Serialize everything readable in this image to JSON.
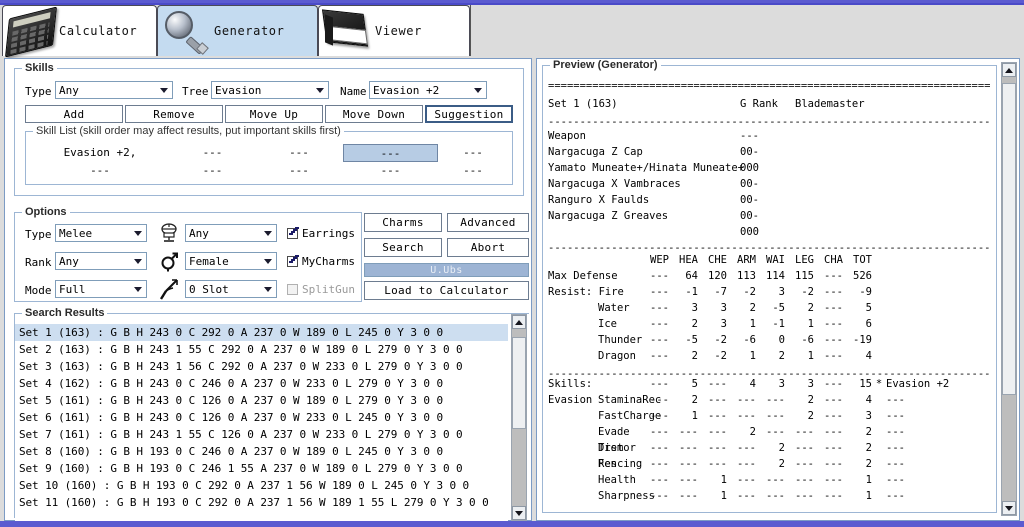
{
  "window": {
    "accent_color": "#5b5bd0",
    "bg_color": "#dcdcdc"
  },
  "tabs": [
    {
      "label": "Calculator",
      "icon": "calculator-icon",
      "active": false
    },
    {
      "label": "Generator",
      "icon": "magnifier-icon",
      "active": true
    },
    {
      "label": "Viewer",
      "icon": "book-icon",
      "active": false
    }
  ],
  "skills": {
    "group_label": "Skills",
    "type_label": "Type",
    "type_value": "Any",
    "tree_label": "Tree",
    "tree_value": "Evasion",
    "name_label": "Name",
    "name_value": "Evasion +2",
    "buttons": [
      {
        "label": "Add",
        "focus": false
      },
      {
        "label": "Remove",
        "focus": false
      },
      {
        "label": "Move Up",
        "focus": false
      },
      {
        "label": "Move Down",
        "focus": false
      },
      {
        "label": "Suggestion",
        "focus": true
      }
    ],
    "skill_list_label": "Skill List  (skill order may affect results, put important skills first)",
    "skill_cells": [
      [
        {
          "text": "Evasion +2,",
          "sel": false
        },
        {
          "text": "---",
          "sel": false
        },
        {
          "text": "---",
          "sel": false
        },
        {
          "text": "---",
          "sel": true
        },
        {
          "text": "---",
          "sel": false
        }
      ],
      [
        {
          "text": "---",
          "sel": false
        },
        {
          "text": "---",
          "sel": false
        },
        {
          "text": "---",
          "sel": false
        },
        {
          "text": "---",
          "sel": false
        },
        {
          "text": "---",
          "sel": false
        }
      ]
    ]
  },
  "options": {
    "group_label": "Options",
    "rows": [
      {
        "label": "Type",
        "value": "Melee"
      },
      {
        "label": "Rank",
        "value": "Any"
      },
      {
        "label": "Mode",
        "value": "Full"
      }
    ],
    "icon_rows": [
      {
        "icon": "armor-helmet-icon",
        "value": "Any"
      },
      {
        "icon": "gender-icon",
        "value": "Female"
      },
      {
        "icon": "weapon-icon",
        "value": "0 Slot"
      }
    ],
    "checks": [
      {
        "label": "Earrings",
        "checked": true,
        "disabled": false
      },
      {
        "label": "MyCharms",
        "checked": true,
        "disabled": false
      },
      {
        "label": "SplitGun",
        "checked": false,
        "disabled": true
      }
    ],
    "action_buttons": [
      {
        "label": "Charms"
      },
      {
        "label": "Advanced"
      },
      {
        "label": "Search"
      },
      {
        "label": "Abort"
      }
    ],
    "progress": {
      "text": "U.Ubs",
      "percent": 100,
      "fill_color": "#9db4d4"
    },
    "load_button": "Load to Calculator"
  },
  "search_results": {
    "group_label": "Search Results",
    "rows": [
      {
        "text": "Set 1 (163) : G B H 243 0 C 292 0 A 237 0 W 189 0 L 245 0 Y 3 0 0",
        "sel": true
      },
      {
        "text": "Set 2 (163) : G B H 243 1 55 C 292 0 A 237 0 W 189 0 L 279 0 Y 3 0 0",
        "sel": false
      },
      {
        "text": "Set 3 (163) : G B H 243 1 56 C 292 0 A 237 0 W 233 0 L 279 0 Y 3 0 0",
        "sel": false
      },
      {
        "text": "Set 4 (162) : G B H 243 0 C 246 0 A 237 0 W 233 0 L 279 0 Y 3 0 0",
        "sel": false
      },
      {
        "text": "Set 5 (161) : G B H 243 0 C 126 0 A 237 0 W 189 0 L 279 0 Y 3 0 0",
        "sel": false
      },
      {
        "text": "Set 6 (161) : G B H 243 0 C 126 0 A 237 0 W 233 0 L 245 0 Y 3 0 0",
        "sel": false
      },
      {
        "text": "Set 7 (161) : G B H 243 1 55 C 126 0 A 237 0 W 233 0 L 279 0 Y 3 0 0",
        "sel": false
      },
      {
        "text": "Set 8 (160) : G B H 193 0 C 246 0 A 237 0 W 189 0 L 245 0 Y 3 0 0",
        "sel": false
      },
      {
        "text": "Set 9 (160) : G B H 193 0 C 246 1 55 A 237 0 W 189 0 L 279 0 Y 3 0 0",
        "sel": false
      },
      {
        "text": "Set 10 (160) : G B H 193 0 C 292 0 A 237 1 56 W 189 0 L 245 0 Y 3 0 0",
        "sel": false
      },
      {
        "text": "Set 11 (160) : G B H 193 0 C 292 0 A 237 1 56 W 189 1 55 L 279 0 Y 3 0 0",
        "sel": false
      }
    ],
    "scrollbar": {
      "thumb_top_pct": 4,
      "thumb_height_pct": 48
    }
  },
  "preview": {
    "group_label": "Preview (Generator)",
    "divider_double": "================================================================================",
    "divider_single": "--------------------------------------------------------------------------------",
    "header": {
      "set": "Set 1 (163)",
      "rank": "G Rank",
      "class": "Blademaster"
    },
    "equipment": [
      {
        "name": "Weapon",
        "slots": "---"
      },
      {
        "name": "Nargacuga Z Cap",
        "slots": "00-"
      },
      {
        "name": "Yamato Muneate+/Hinata Muneate+",
        "slots": "000"
      },
      {
        "name": "Nargacuga X Vambraces",
        "slots": "00-"
      },
      {
        "name": "Ranguro X Faulds",
        "slots": "00-"
      },
      {
        "name": "Nargacuga Z Greaves",
        "slots": "00-"
      },
      {
        "name": "",
        "slots": "000"
      }
    ],
    "stat_columns": [
      "WEP",
      "HEA",
      "CHE",
      "ARM",
      "WAI",
      "LEG",
      "CHA",
      "TOT"
    ],
    "stat_rows": [
      {
        "label": "Max Defense",
        "indent": 0,
        "values": [
          "---",
          "64",
          "120",
          "113",
          "114",
          "115",
          "---",
          "526"
        ]
      },
      {
        "label": "Resist: Fire",
        "indent": 0,
        "values": [
          "---",
          "-1",
          "-7",
          "-2",
          "3",
          "-2",
          "---",
          "-9"
        ]
      },
      {
        "label": "Water",
        "indent": 1,
        "values": [
          "---",
          "3",
          "3",
          "2",
          "-5",
          "2",
          "---",
          "5"
        ]
      },
      {
        "label": "Ice",
        "indent": 1,
        "values": [
          "---",
          "2",
          "3",
          "1",
          "-1",
          "1",
          "---",
          "6"
        ]
      },
      {
        "label": "Thunder",
        "indent": 1,
        "values": [
          "---",
          "-5",
          "-2",
          "-6",
          "0",
          "-6",
          "---",
          "-19"
        ]
      },
      {
        "label": "Dragon",
        "indent": 1,
        "values": [
          "---",
          "2",
          "-2",
          "1",
          "2",
          "1",
          "---",
          "4"
        ]
      }
    ],
    "skill_rows": [
      {
        "label": "Skills: Evasion",
        "indent": 0,
        "values": [
          "---",
          "5",
          "---",
          "4",
          "3",
          "3",
          "---"
        ],
        "total": "15",
        "mark": "*",
        "name": "Evasion +2"
      },
      {
        "label": "StaminaRec",
        "indent": 1,
        "values": [
          "---",
          "2",
          "---",
          "---",
          "---",
          "2",
          "---"
        ],
        "total": "4",
        "mark": "",
        "name": "---"
      },
      {
        "label": "FastCharge",
        "indent": 1,
        "values": [
          "---",
          "1",
          "---",
          "---",
          "---",
          "2",
          "---"
        ],
        "total": "3",
        "mark": "",
        "name": "---"
      },
      {
        "label": "Evade Dist",
        "indent": 1,
        "values": [
          "---",
          "---",
          "---",
          "2",
          "---",
          "---",
          "---"
        ],
        "total": "2",
        "mark": "",
        "name": "---"
      },
      {
        "label": "Tremor Res",
        "indent": 1,
        "values": [
          "---",
          "---",
          "---",
          "---",
          "2",
          "---",
          "---"
        ],
        "total": "2",
        "mark": "",
        "name": "---"
      },
      {
        "label": "Fencing",
        "indent": 1,
        "values": [
          "---",
          "---",
          "---",
          "---",
          "2",
          "---",
          "---"
        ],
        "total": "2",
        "mark": "",
        "name": "---"
      },
      {
        "label": "Health",
        "indent": 1,
        "values": [
          "---",
          "---",
          "1",
          "---",
          "---",
          "---",
          "---"
        ],
        "total": "1",
        "mark": "",
        "name": "---"
      },
      {
        "label": "Sharpness",
        "indent": 1,
        "values": [
          "---",
          "---",
          "1",
          "---",
          "---",
          "---",
          "---"
        ],
        "total": "1",
        "mark": "",
        "name": "---"
      }
    ],
    "scrollbar": {
      "thumb_top_pct": 2,
      "thumb_height_pct": 70
    }
  }
}
